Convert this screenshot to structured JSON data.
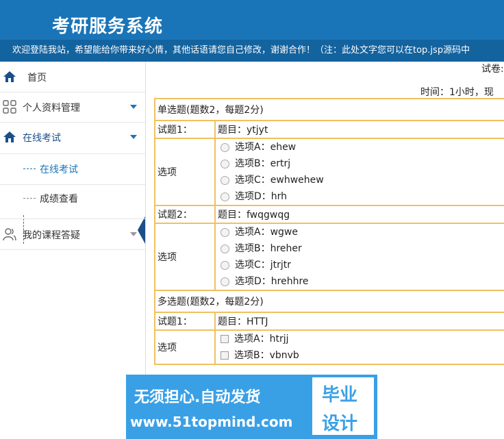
{
  "header": {
    "title": "考研服务系统",
    "marquee": "欢迎登陆我站，希望能给你带来好心情，其他话语请您自己修改，谢谢合作！（注：此处文字您可以在top.jsp源码中"
  },
  "sidebar": {
    "home": "首页",
    "profile": "个人资料管理",
    "exam": "在线考试",
    "exam_sub": [
      "在线考试",
      "成绩查看"
    ],
    "qa": "我的课程答疑"
  },
  "main": {
    "exam_title": "试卷:",
    "exam_info": "时间：1小时，现",
    "single": {
      "header": "单选题(题数2，每题2分)",
      "questions": [
        {
          "label": "试题1：",
          "title": "题目：ytjyt",
          "options_label": "选项",
          "options": [
            "选项A：ehew",
            "选项B：ertrj",
            "选项C：ewhwehew",
            "选项D：hrh"
          ]
        },
        {
          "label": "试题2：",
          "title": "题目：fwqgwqg",
          "options_label": "选项",
          "options": [
            "选项A：wgwe",
            "选项B：hreher",
            "选项C：jtrjtr",
            "选项D：hrehhre"
          ]
        }
      ]
    },
    "multi": {
      "header": "多选题(题数2，每题2分)",
      "questions": [
        {
          "label": "试题1：",
          "title": "题目：HTTJ",
          "options_label": "选项",
          "options": [
            "选项A：htrjj",
            "选项B：vbnvb"
          ]
        }
      ]
    }
  },
  "watermark": {
    "line1": "无须担心.自动发货",
    "line2": "www.51topmind.com",
    "box1": "毕业",
    "box2": "设计"
  }
}
